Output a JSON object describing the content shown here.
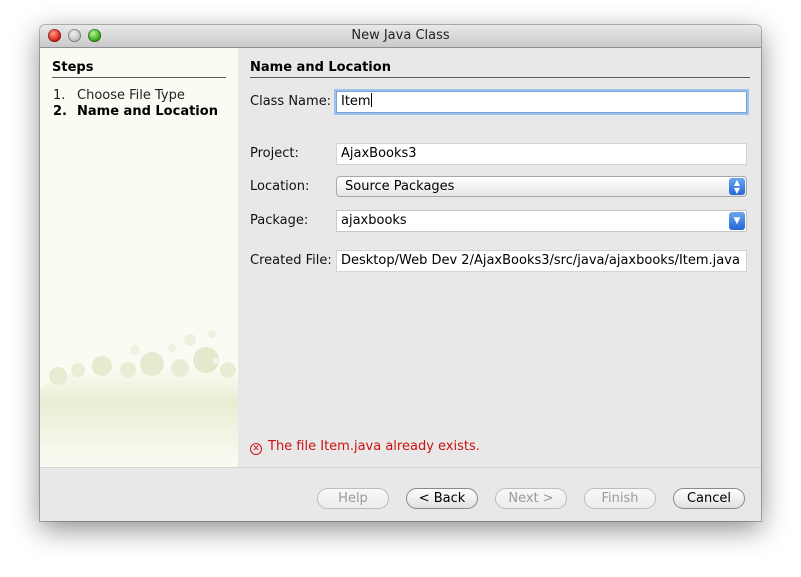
{
  "window": {
    "title": "New Java Class"
  },
  "steps": {
    "heading": "Steps",
    "items": [
      {
        "num": "1.",
        "label": "Choose File Type"
      },
      {
        "num": "2.",
        "label": "Name and Location"
      }
    ]
  },
  "main": {
    "heading": "Name and Location",
    "class_name": {
      "label": "Class Name:",
      "value": "Item"
    },
    "project": {
      "label": "Project:",
      "value": "AjaxBooks3"
    },
    "location": {
      "label": "Location:",
      "value": "Source Packages"
    },
    "package": {
      "label": "Package:",
      "value": "ajaxbooks"
    },
    "created_file": {
      "label": "Created File:",
      "value": "Desktop/Web Dev 2/AjaxBooks3/src/java/ajaxbooks/Item.java"
    },
    "error_message": "The file Item.java already exists."
  },
  "buttons": {
    "help": "Help",
    "back": "< Back",
    "next": "Next >",
    "finish": "Finish",
    "cancel": "Cancel"
  },
  "colors": {
    "error": "#cc1111",
    "focus_ring": "#9cc2ef",
    "side_panel": "#fafbf3"
  }
}
